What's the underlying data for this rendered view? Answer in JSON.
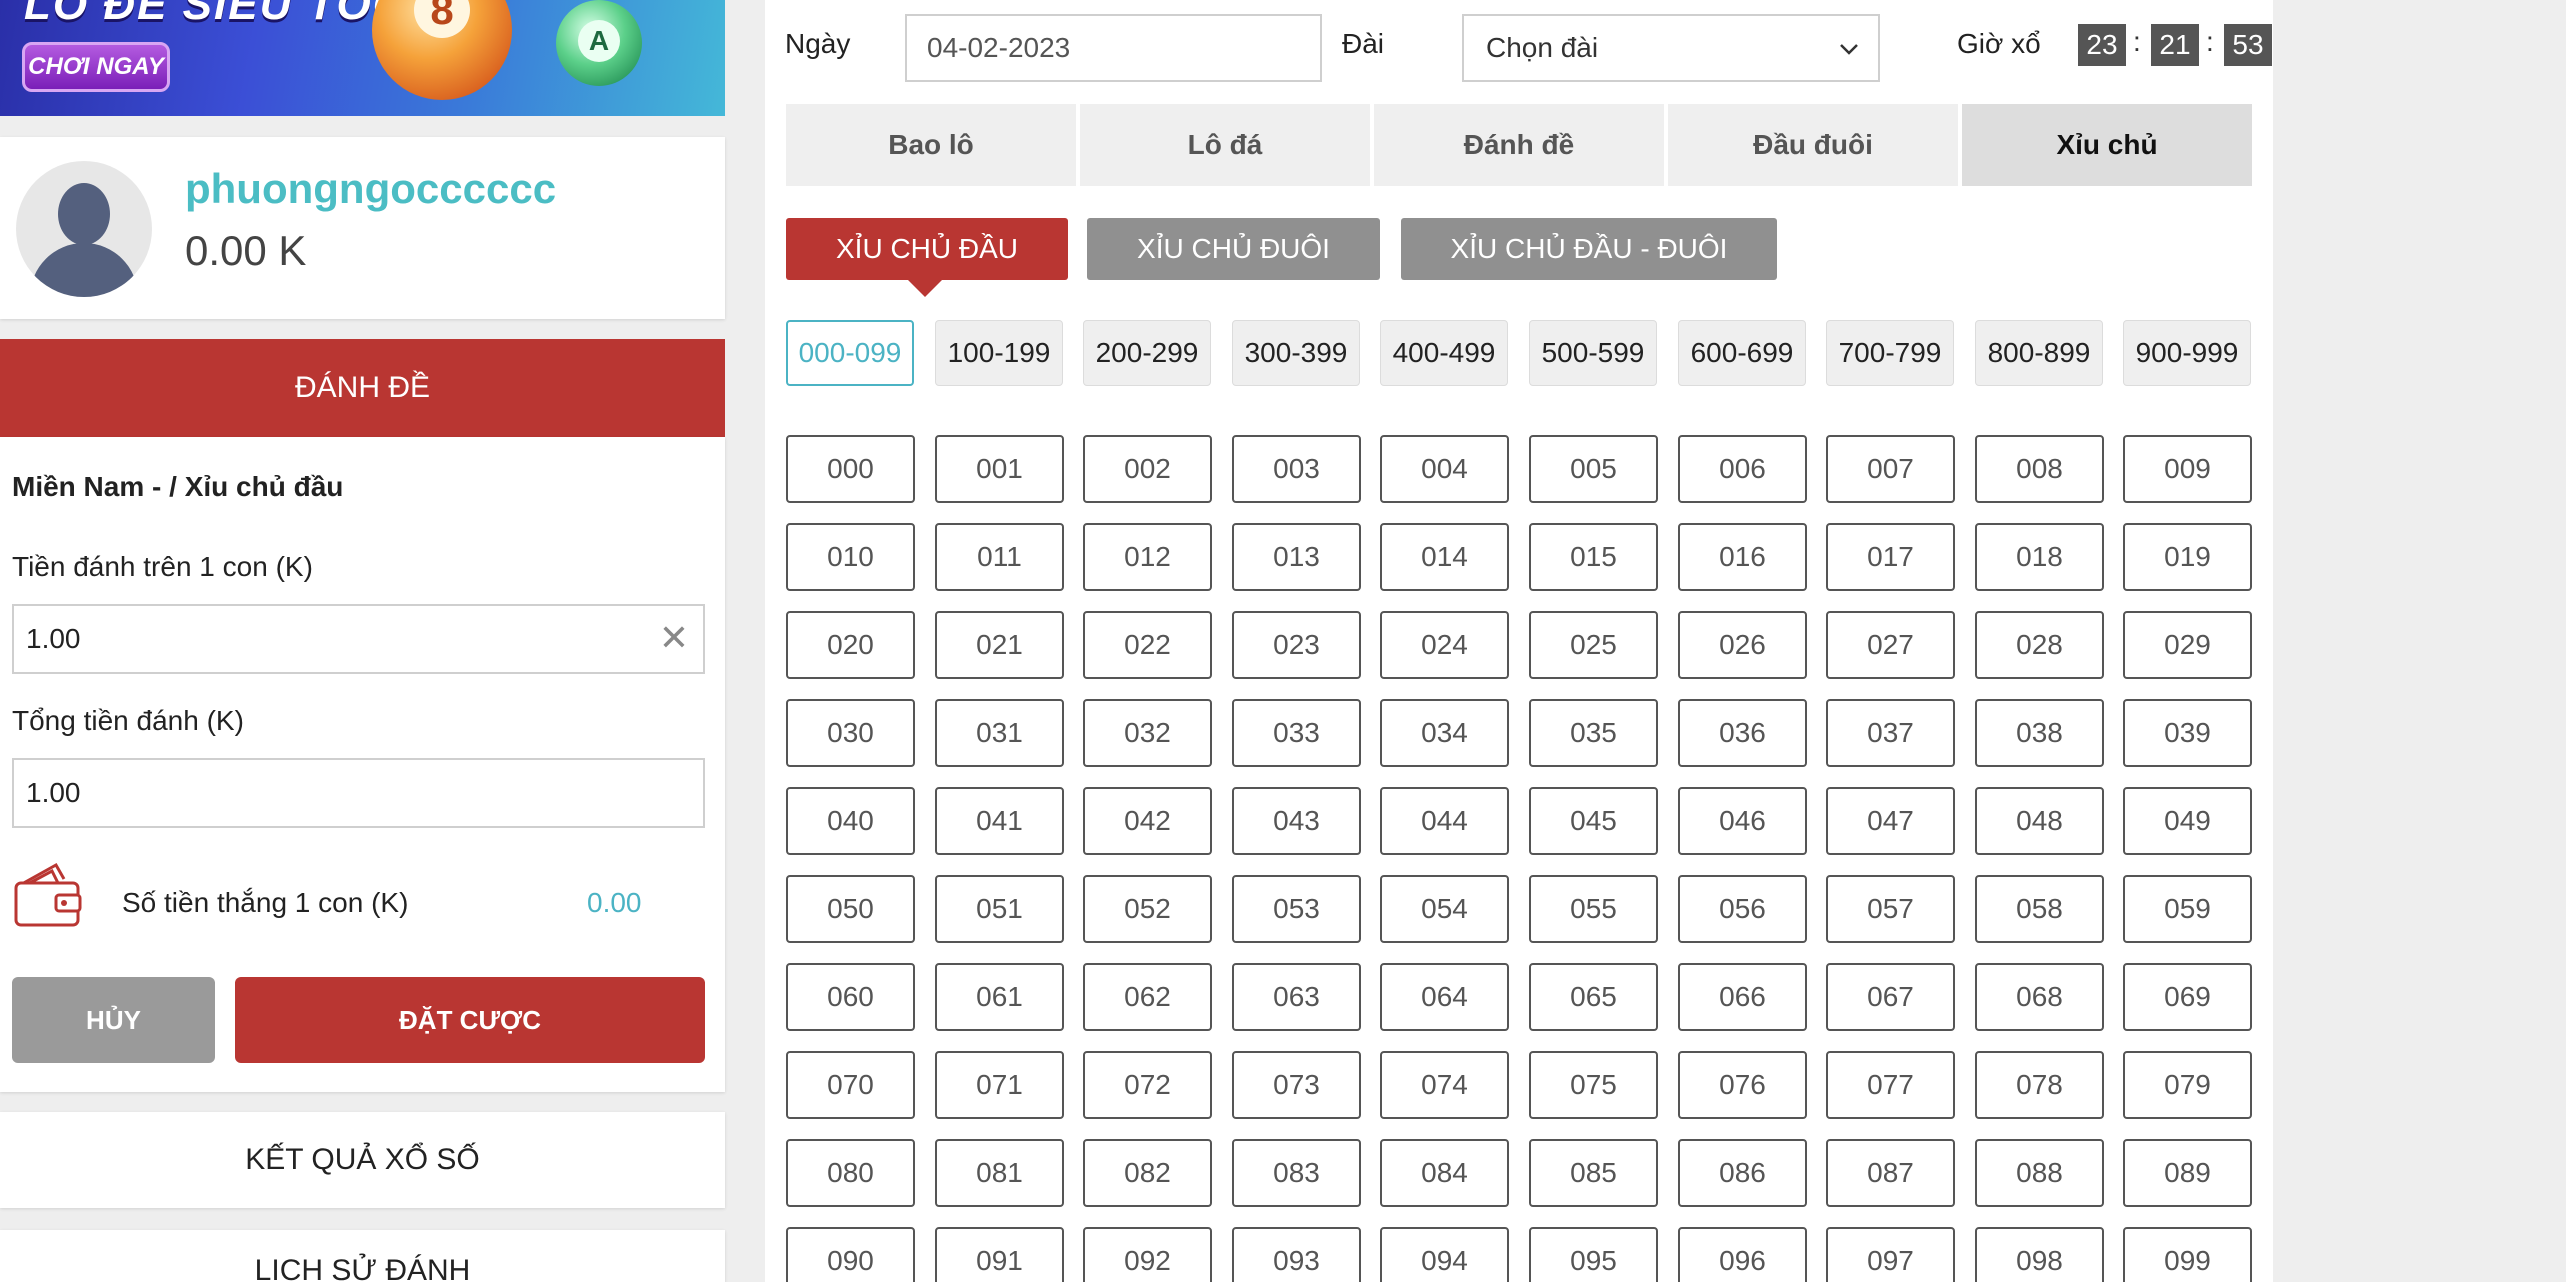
{
  "banner": {
    "title": "LÔ ĐỀ SIÊU TỐC",
    "play_label": "CHƠI NGAY",
    "ball_numbers": [
      "8",
      "A"
    ]
  },
  "profile": {
    "username": "phuongngocccccc",
    "balance": "0.00 K"
  },
  "left_header": "ĐÁNH ĐỀ",
  "bet": {
    "title": "Miền Nam - / Xỉu chủ đầu",
    "stake_label": "Tiền đánh trên 1 con (K)",
    "stake_value": "1.00",
    "total_label": "Tổng tiền đánh (K)",
    "total_value": "1.00",
    "win_label": "Số tiền thắng 1 con (K)",
    "win_value": "0.00",
    "cancel_label": "HỦY",
    "submit_label": "ĐẶT CƯỢC"
  },
  "nav": {
    "results": "KẾT QUẢ XỔ SỐ",
    "history": "LỊCH SỬ ĐÁNH"
  },
  "filter": {
    "date_label": "Ngày",
    "date_value": "04-02-2023",
    "station_label": "Đài",
    "station_value": "Chọn đài",
    "timer_label": "Giờ xổ",
    "hh": "23",
    "mm": "21",
    "ss": "53",
    "sep": ":"
  },
  "tabs": [
    "Bao lô",
    "Lô đá",
    "Đánh đề",
    "Đầu đuôi",
    "Xỉu chủ"
  ],
  "active_tab": 4,
  "sub_tabs": [
    "XỈU CHỦ ĐẦU",
    "XỈU CHỦ ĐUÔI",
    "XỈU CHỦ ĐẦU - ĐUÔI"
  ],
  "ranges": [
    "000-099",
    "100-199",
    "200-299",
    "300-399",
    "400-499",
    "500-599",
    "600-699",
    "700-799",
    "800-899",
    "900-999"
  ],
  "active_range": 0,
  "numbers": [
    "000",
    "001",
    "002",
    "003",
    "004",
    "005",
    "006",
    "007",
    "008",
    "009",
    "010",
    "011",
    "012",
    "013",
    "014",
    "015",
    "016",
    "017",
    "018",
    "019",
    "020",
    "021",
    "022",
    "023",
    "024",
    "025",
    "026",
    "027",
    "028",
    "029",
    "030",
    "031",
    "032",
    "033",
    "034",
    "035",
    "036",
    "037",
    "038",
    "039",
    "040",
    "041",
    "042",
    "043",
    "044",
    "045",
    "046",
    "047",
    "048",
    "049",
    "050",
    "051",
    "052",
    "053",
    "054",
    "055",
    "056",
    "057",
    "058",
    "059",
    "060",
    "061",
    "062",
    "063",
    "064",
    "065",
    "066",
    "067",
    "068",
    "069",
    "070",
    "071",
    "072",
    "073",
    "074",
    "075",
    "076",
    "077",
    "078",
    "079",
    "080",
    "081",
    "082",
    "083",
    "084",
    "085",
    "086",
    "087",
    "088",
    "089",
    "090",
    "091",
    "092",
    "093",
    "094",
    "095",
    "096",
    "097",
    "098",
    "099"
  ],
  "colors": {
    "accent_red": "#b93632",
    "teal": "#4bb3c4",
    "username": "#4bbdc4"
  }
}
